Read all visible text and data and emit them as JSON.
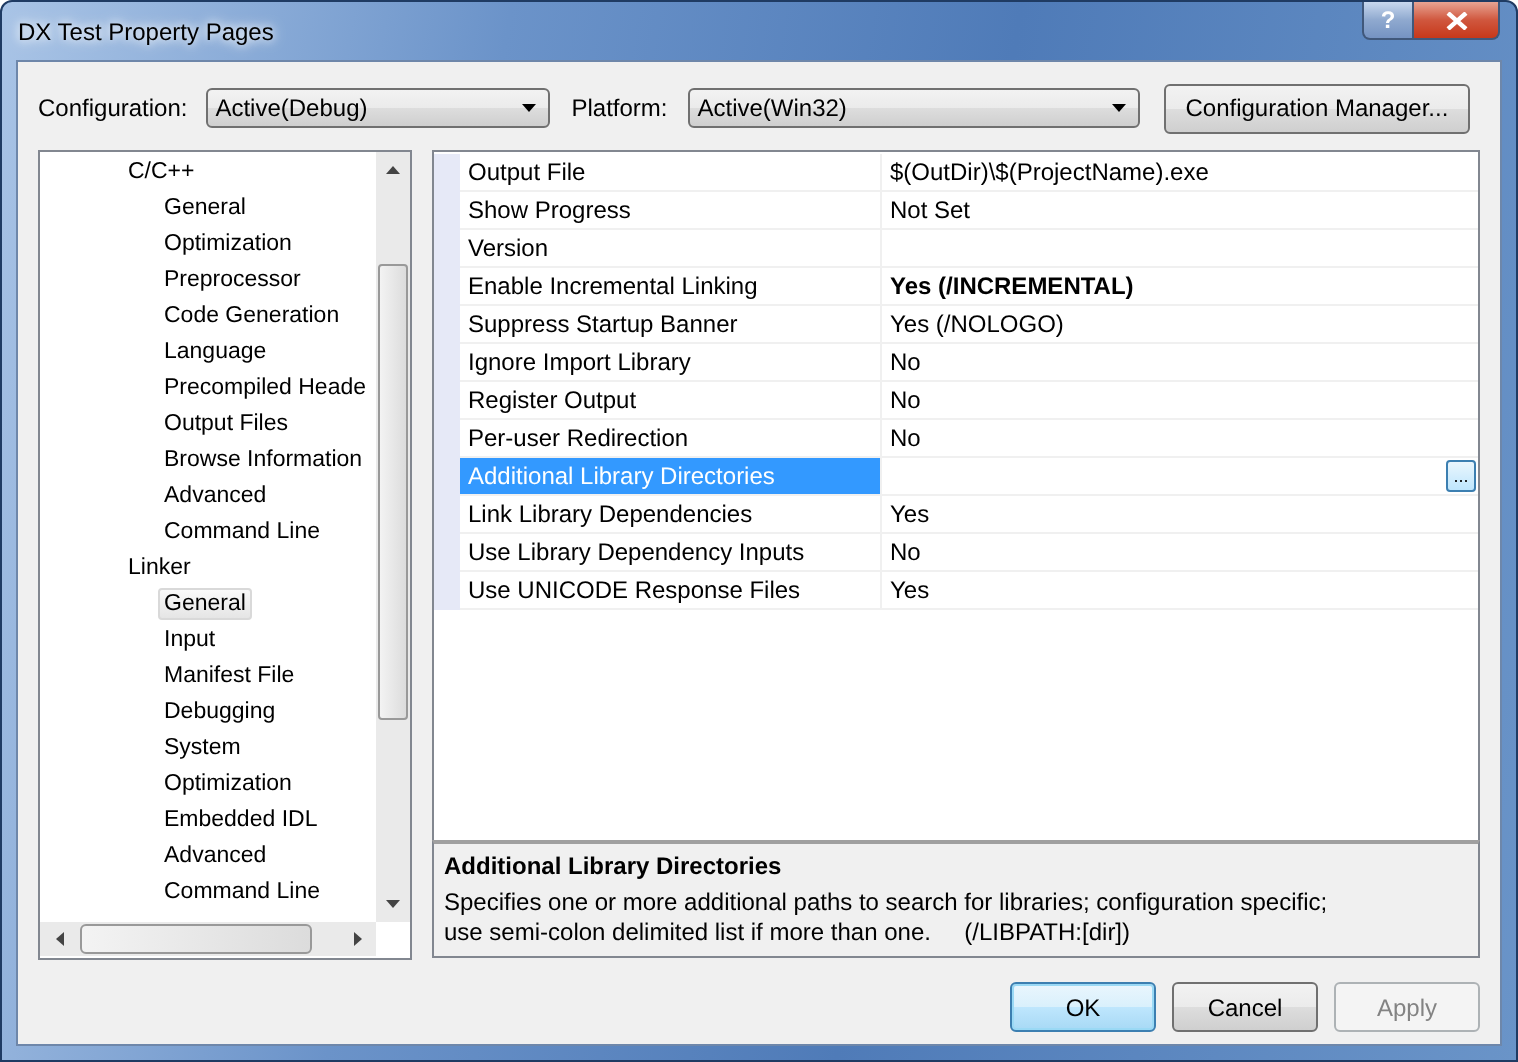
{
  "window": {
    "title": "DX Test Property Pages",
    "help_button": "?"
  },
  "configuration": {
    "label": "Configuration:",
    "value": "Active(Debug)"
  },
  "platform": {
    "label": "Platform:",
    "value": "Active(Win32)"
  },
  "configuration_manager_button": "Configuration Manager...",
  "tree": [
    {
      "label": "C/C++",
      "selected": false,
      "children": [
        {
          "label": "General",
          "selected": false
        },
        {
          "label": "Optimization",
          "selected": false
        },
        {
          "label": "Preprocessor",
          "selected": false
        },
        {
          "label": "Code Generation",
          "selected": false
        },
        {
          "label": "Language",
          "selected": false
        },
        {
          "label": "Precompiled Heade",
          "selected": false
        },
        {
          "label": "Output Files",
          "selected": false
        },
        {
          "label": "Browse Information",
          "selected": false
        },
        {
          "label": "Advanced",
          "selected": false
        },
        {
          "label": "Command Line",
          "selected": false
        }
      ]
    },
    {
      "label": "Linker",
      "selected": false,
      "children": [
        {
          "label": "General",
          "selected": true
        },
        {
          "label": "Input",
          "selected": false
        },
        {
          "label": "Manifest File",
          "selected": false
        },
        {
          "label": "Debugging",
          "selected": false
        },
        {
          "label": "System",
          "selected": false
        },
        {
          "label": "Optimization",
          "selected": false
        },
        {
          "label": "Embedded IDL",
          "selected": false
        },
        {
          "label": "Advanced",
          "selected": false
        },
        {
          "label": "Command Line",
          "selected": false
        }
      ]
    }
  ],
  "properties": [
    {
      "name": "Output File",
      "value": "$(OutDir)\\$(ProjectName).exe",
      "bold": false,
      "selected": false
    },
    {
      "name": "Show Progress",
      "value": "Not Set",
      "bold": false,
      "selected": false
    },
    {
      "name": "Version",
      "selected": false
    },
    {
      "name": "Enable Incremental Linking",
      "value": "Yes (/INCREMENTAL)",
      "bold": true,
      "selected": false
    },
    {
      "name": "Suppress Startup Banner",
      "value": "Yes (/NOLOGO)",
      "bold": false,
      "selected": false
    },
    {
      "name": "Ignore Import Library",
      "value": "No",
      "bold": false,
      "selected": false
    },
    {
      "name": "Register Output",
      "value": "No",
      "bold": false,
      "selected": false
    },
    {
      "name": "Per-user Redirection",
      "value": "No",
      "bold": false,
      "selected": false
    },
    {
      "name": "Additional Library Directories",
      "selected": true,
      "browse_button": "..."
    },
    {
      "name": "Link Library Dependencies",
      "value": "Yes",
      "bold": false,
      "selected": false
    },
    {
      "name": "Use Library Dependency Inputs",
      "value": "No",
      "bold": false,
      "selected": false
    },
    {
      "name": "Use UNICODE Response Files",
      "value": "Yes",
      "bold": false,
      "selected": false
    }
  ],
  "description": {
    "title": "Additional Library Directories",
    "text": "Specifies one or more additional paths to search for libraries; configuration specific; use semi-colon delimited list if more than one.     (/LIBPATH:[dir])"
  },
  "buttons": [
    {
      "label": "OK",
      "kind": "default",
      "disabled": false
    },
    {
      "label": "Cancel",
      "kind": "normal",
      "disabled": false
    },
    {
      "label": "Apply",
      "kind": "normal",
      "disabled": true
    }
  ]
}
